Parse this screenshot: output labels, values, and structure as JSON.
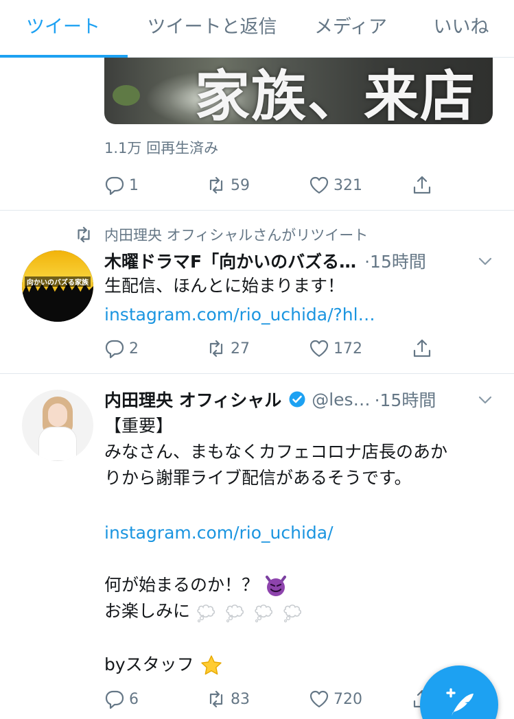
{
  "tabs": [
    {
      "label": "ツイート",
      "active": true
    },
    {
      "label": "ツイートと返信",
      "active": false
    },
    {
      "label": "メディア",
      "active": false
    },
    {
      "label": "いいね",
      "active": false
    }
  ],
  "media_caption": "家族、来店",
  "tweet0": {
    "views": "1.1万 回再生済み",
    "replies": "1",
    "retweets": "59",
    "likes": "321"
  },
  "tweet1": {
    "retweeted_by": "内田理央 オフィシャルさんがリツイート",
    "name": "木曜ドラマF「向かいのバズる…",
    "time": "·15時間",
    "avatar_label": "向かいのバズる家族",
    "text": "生配信、ほんとに始まります！",
    "link": "instagram.com/rio_uchida/?hl…",
    "replies": "2",
    "retweets": "27",
    "likes": "172"
  },
  "tweet2": {
    "name": "内田理央 オフィシャル",
    "handle": "@les…",
    "time": "·15時間",
    "lines": {
      "l1": "【重要】",
      "l2": "みなさん、まもなくカフェコロナ店長のあか",
      "l3": "りから謝罪ライブ配信があるそうです。",
      "link": "instagram.com/rio_uchida/",
      "l5": "何が始まるのか！？",
      "l6": "お楽しみに",
      "l7": "byスタッフ"
    },
    "replies": "6",
    "retweets": "83",
    "likes": "720"
  },
  "icons": {
    "reply": "reply-icon",
    "retweet": "retweet-icon",
    "like": "heart-icon",
    "share": "share-icon",
    "verified": "verified-badge-icon",
    "compose": "compose-tweet-icon"
  },
  "colors": {
    "accent": "#1da1f2",
    "link": "#1b95e0",
    "muted": "#657786"
  }
}
